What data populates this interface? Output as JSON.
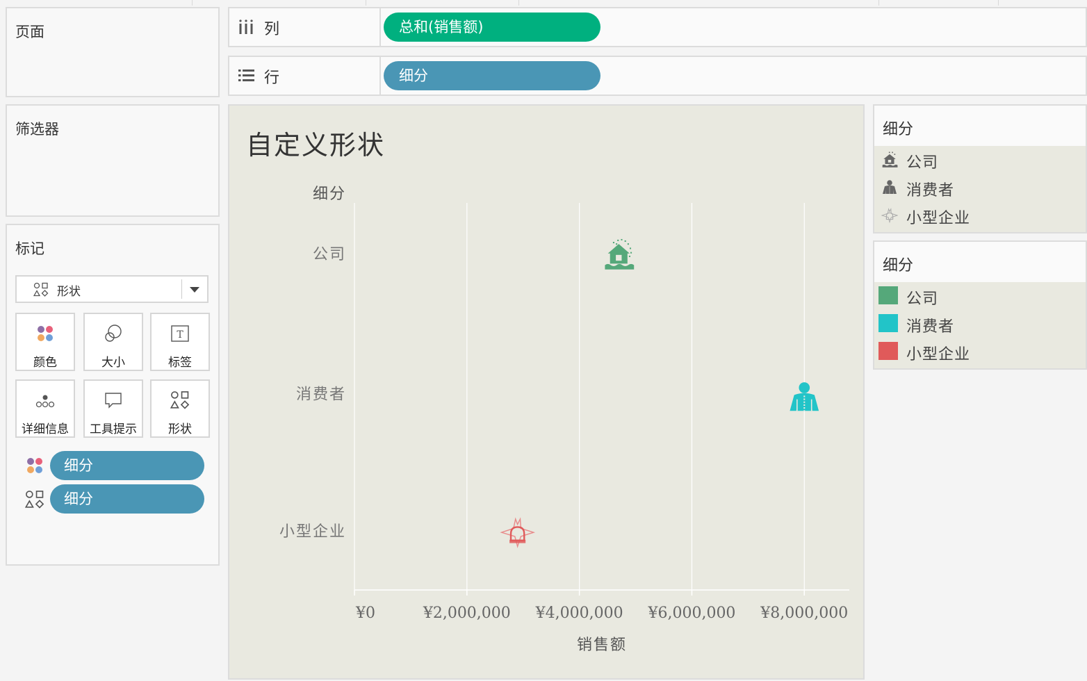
{
  "pages_panel": {
    "title": "页面"
  },
  "filters_panel": {
    "title": "筛选器"
  },
  "columns_shelf": {
    "label": "列",
    "pill": "总和(销售额)",
    "pill_color": "#00b07f"
  },
  "rows_shelf": {
    "label": "行",
    "pill": "细分",
    "pill_color": "#4a96b5"
  },
  "marks": {
    "title": "标记",
    "mark_type": "形状",
    "buttons": {
      "color": "颜色",
      "size": "大小",
      "label": "标签",
      "detail": "详细信息",
      "tooltip": "工具提示",
      "shape": "形状"
    },
    "pills": [
      "细分",
      "细分"
    ]
  },
  "chart": {
    "title": "自定义形状",
    "row_header": "细分",
    "x_axis_title": "销售额"
  },
  "chart_data": {
    "type": "scatter",
    "categories": [
      "公司",
      "消费者",
      "小型企业"
    ],
    "x": [
      4.7,
      8.0,
      2.9
    ],
    "x_unit": "million yuan",
    "xlim": [
      0,
      8.8
    ],
    "x_ticks": [
      0,
      2,
      4,
      6,
      8
    ],
    "x_tick_labels": [
      "¥0",
      "¥2,000,000",
      "¥4,000,000",
      "¥6,000,000",
      "¥8,000,000"
    ],
    "xlabel": "销售额",
    "ylabel": "细分",
    "title": "自定义形状",
    "colors": [
      "#55a87a",
      "#22c4c8",
      "#e05a5a"
    ],
    "shapes": [
      "house-flood-icon",
      "consumer-person-icon",
      "small-business-star-icon"
    ],
    "grid": "vertical"
  },
  "shape_legend": {
    "title": "细分",
    "items": [
      {
        "label": "公司",
        "icon": "house-flood-icon"
      },
      {
        "label": "消费者",
        "icon": "consumer-person-icon"
      },
      {
        "label": "小型企业",
        "icon": "small-business-star-icon"
      }
    ]
  },
  "color_legend": {
    "title": "细分",
    "items": [
      {
        "label": "公司",
        "color": "#55a87a"
      },
      {
        "label": "消费者",
        "color": "#22c4c8"
      },
      {
        "label": "小型企业",
        "color": "#e05a5a"
      }
    ]
  }
}
